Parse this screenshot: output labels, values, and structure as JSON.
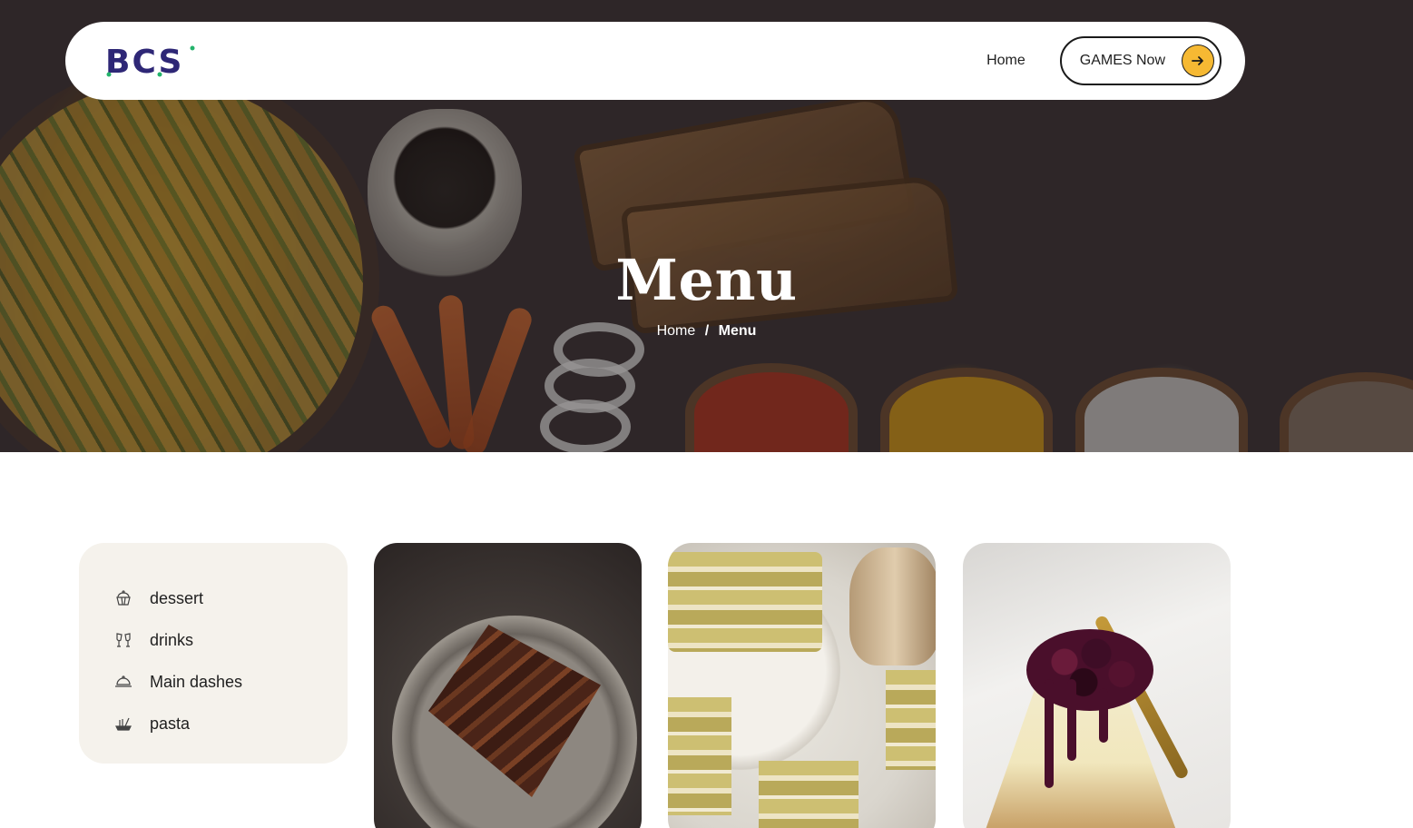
{
  "navbar": {
    "logo_text": "BCS",
    "links": [
      {
        "label": "Home"
      }
    ],
    "cta_label": "GAMES Now",
    "cta_icon": "arrow-right-icon"
  },
  "hero": {
    "title": "Menu",
    "breadcrumb": {
      "home": "Home",
      "separator": "/",
      "current": "Menu"
    }
  },
  "categories": [
    {
      "label": "dessert",
      "icon": "cupcake-icon"
    },
    {
      "label": "drinks",
      "icon": "cheers-glasses-icon"
    },
    {
      "label": "Main dashes",
      "icon": "serving-dish-icon"
    },
    {
      "label": "pasta",
      "icon": "noodles-icon"
    }
  ],
  "cards": [
    {
      "name": "chocolate-cake-card"
    },
    {
      "name": "pistachio-cake-card"
    },
    {
      "name": "cheesecake-card"
    }
  ],
  "colors": {
    "brand": "#2e2776",
    "accent": "#f6b933",
    "panel": "#f5f2ec"
  }
}
